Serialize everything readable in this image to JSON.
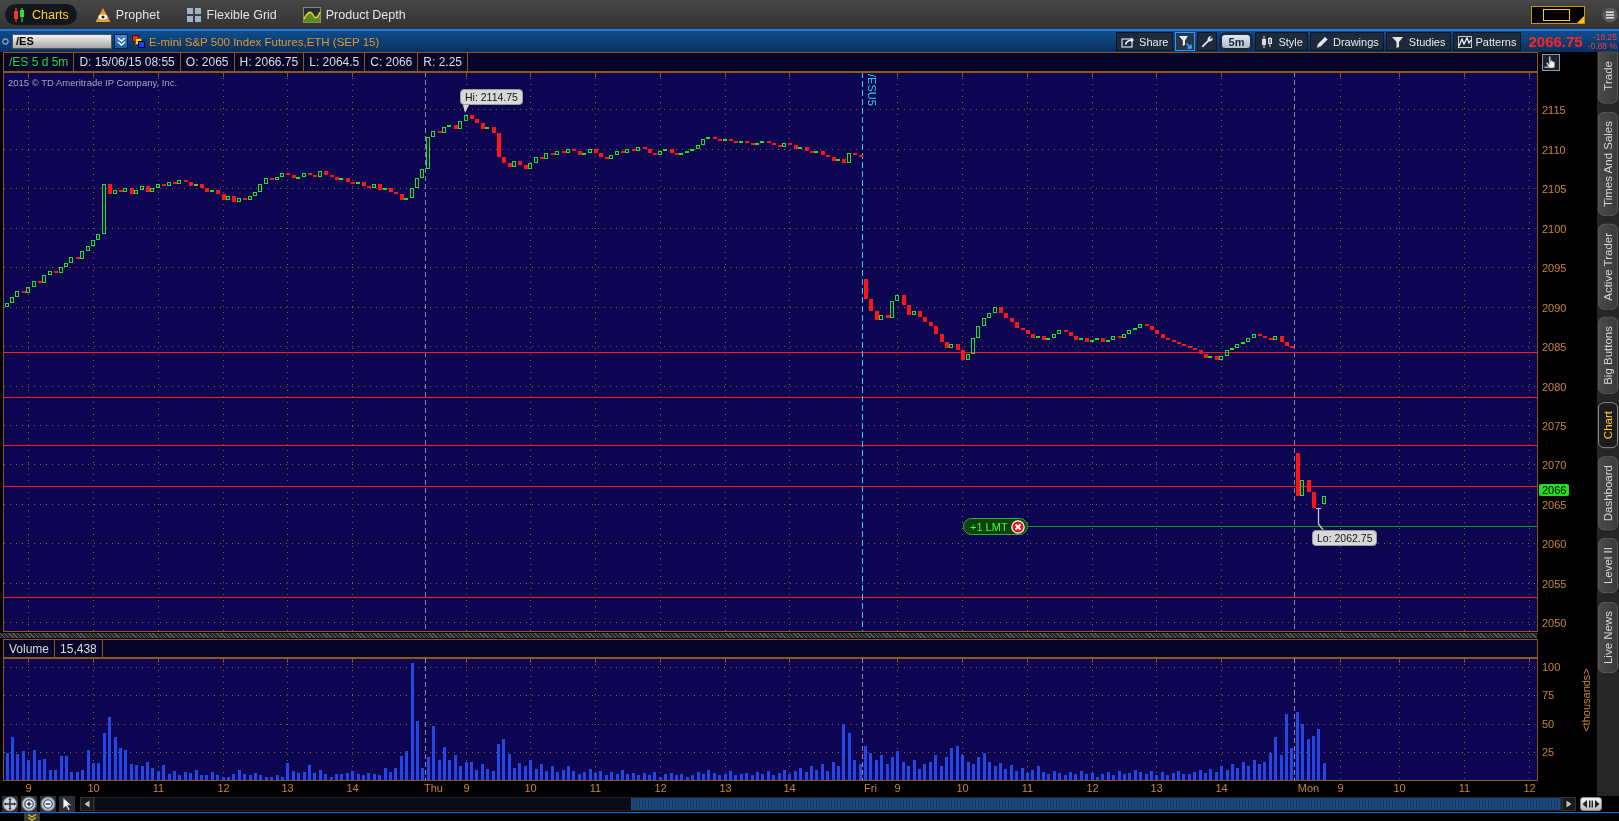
{
  "app_tabs": [
    {
      "label": "Charts",
      "selected": true
    },
    {
      "label": "Prophet",
      "selected": false
    },
    {
      "label": "Flexible Grid",
      "selected": false
    },
    {
      "label": "Product Depth",
      "selected": false
    }
  ],
  "symbol_bar": {
    "symbol": "/ES",
    "description": "E-mini S&P 500 Index Futures,ETH (SEP 15)",
    "buttons": [
      {
        "kind": "text",
        "label": "Share",
        "active": false
      },
      {
        "kind": "icon",
        "active": true
      },
      {
        "kind": "icon",
        "active": false
      },
      {
        "kind": "pill",
        "label": "5m",
        "active": false
      },
      {
        "kind": "text",
        "label": "Style",
        "active": false
      },
      {
        "kind": "text",
        "label": "Drawings",
        "active": false
      },
      {
        "kind": "text",
        "label": "Studies",
        "active": false
      },
      {
        "kind": "text",
        "label": "Patterns",
        "active": false
      }
    ],
    "last_price": "2066.75",
    "net_change": "-18.25",
    "percent_change": "-0.88 %"
  },
  "info_bar": {
    "period": "/ES 5 d 5m",
    "fields": [
      "D: 15/06/15 08:55",
      "O: 2065",
      "H: 2066.75",
      "L: 2064.5",
      "C: 2066",
      "R: 2.25"
    ]
  },
  "price_panel": {
    "copyright": "2015 © TD Ameritrade IP Company, Inc.",
    "axis_labels": [
      "2115",
      "2110",
      "2105",
      "2100",
      "2095",
      "2090",
      "2085",
      "2080",
      "2075",
      "2070",
      "2065",
      "2060",
      "2055",
      "2050"
    ],
    "high_label": "Hi: 2114.75",
    "low_label": "Lo: 2062.75",
    "contract_marker": "/ESU5",
    "order_label": "+1 LMT",
    "last_price_tag": "2066"
  },
  "volume_panel": {
    "title": "Volume",
    "reading": "15,438",
    "chart_data": {
      "type": "bar",
      "ylabel": "<thousands>",
      "grid": true,
      "ylim": [
        0,
        108
      ],
      "yticks": [
        25,
        50,
        75,
        100
      ],
      "categories": [
        null,
        null,
        null,
        null,
        "9",
        null,
        null,
        null,
        null,
        null,
        null,
        null,
        null,
        null,
        null,
        null,
        "10",
        null,
        null,
        null,
        null,
        null,
        null,
        null,
        null,
        null,
        null,
        null,
        "11",
        null,
        null,
        null,
        null,
        null,
        null,
        null,
        null,
        null,
        null,
        null,
        "12",
        null,
        null,
        null,
        null,
        null,
        null,
        null,
        null,
        null,
        null,
        null,
        "13",
        null,
        null,
        null,
        null,
        null,
        null,
        null,
        null,
        null,
        null,
        null,
        "14",
        null,
        null,
        null,
        null,
        null,
        null,
        null,
        null,
        null,
        null,
        null,
        null,
        null,
        null,
        "Thu",
        null,
        null,
        null,
        null,
        null,
        "9",
        null,
        null,
        null,
        null,
        null,
        null,
        null,
        null,
        null,
        null,
        null,
        "10",
        null,
        null,
        null,
        null,
        null,
        null,
        null,
        null,
        null,
        null,
        null,
        "11",
        null,
        null,
        null,
        null,
        null,
        null,
        null,
        null,
        null,
        null,
        null,
        "12",
        null,
        null,
        null,
        null,
        null,
        null,
        null,
        null,
        null,
        null,
        null,
        "13",
        null,
        null,
        null,
        null,
        null,
        null,
        null,
        null,
        null,
        null,
        null,
        "14",
        null,
        null,
        null,
        null,
        null,
        null,
        null,
        null,
        null,
        null,
        null,
        null,
        null,
        null,
        "Fri",
        null,
        null,
        null,
        null,
        "9",
        null,
        null,
        null,
        null,
        null,
        null,
        null,
        null,
        null,
        null,
        null,
        "10",
        null,
        null,
        null,
        null,
        null,
        null,
        null,
        null,
        null,
        null,
        null,
        "11",
        null,
        null,
        null,
        null,
        null,
        null,
        null,
        null,
        null,
        null,
        null,
        "12",
        null,
        null,
        null,
        null,
        null,
        null,
        null,
        null,
        null,
        null,
        null,
        "13",
        null,
        null,
        null,
        null,
        null,
        null,
        null,
        null,
        null,
        null,
        null,
        "14",
        null,
        null,
        null,
        null,
        null,
        null,
        null,
        null,
        null,
        null,
        null,
        null,
        null,
        null,
        null,
        "Mon",
        null,
        null,
        null,
        null,
        null,
        "9",
        null,
        null,
        null,
        null,
        null,
        null,
        null,
        null,
        null,
        null,
        "10",
        null,
        null,
        null,
        null,
        null,
        null,
        null,
        null,
        null,
        null,
        null,
        "11",
        null,
        null,
        null,
        null,
        null,
        null,
        null,
        null,
        null,
        null,
        null,
        "12",
        null
      ],
      "values": [
        24,
        38,
        23,
        26,
        18,
        27,
        18,
        19,
        9,
        9,
        21,
        21,
        7,
        7,
        9,
        27,
        15,
        15,
        42,
        56,
        38,
        28,
        27,
        14,
        13,
        12,
        16,
        11,
        8,
        13,
        5,
        8,
        4,
        7,
        6,
        9,
        4,
        4,
        7,
        4,
        3,
        3,
        5,
        9,
        5,
        4,
        6,
        4,
        3,
        3,
        4,
        3,
        15,
        8,
        6,
        7,
        13,
        6,
        9,
        5,
        3,
        5,
        5,
        6,
        8,
        5,
        4,
        6,
        5,
        4,
        11,
        7,
        11,
        21,
        26,
        104,
        52,
        11,
        20,
        48,
        18,
        29,
        18,
        22,
        12,
        16,
        16,
        9,
        14,
        10,
        8,
        32,
        36,
        23,
        11,
        15,
        12,
        18,
        10,
        14,
        8,
        12,
        7,
        9,
        12,
        8,
        5,
        7,
        10,
        6,
        8,
        4,
        7,
        5,
        9,
        5,
        6,
        4,
        6,
        4,
        7,
        3,
        5,
        6,
        4,
        5,
        3,
        4,
        7,
        5,
        9,
        6,
        4,
        5,
        8,
        4,
        5,
        6,
        4,
        7,
        5,
        8,
        4,
        6,
        9,
        5,
        8,
        11,
        7,
        12,
        9,
        14,
        8,
        16,
        12,
        50,
        42,
        18,
        14,
        30,
        24,
        18,
        22,
        14,
        20,
        26,
        16,
        12,
        18,
        10,
        14,
        16,
        22,
        12,
        20,
        28,
        30,
        22,
        16,
        14,
        20,
        24,
        16,
        12,
        15,
        10,
        13,
        8,
        11,
        6,
        9,
        12,
        7,
        5,
        8,
        6,
        4,
        7,
        5,
        8,
        5,
        6,
        3,
        5,
        7,
        4,
        8,
        5,
        6,
        9,
        7,
        5,
        8,
        4,
        7,
        4,
        6,
        8,
        5,
        5,
        7,
        9,
        6,
        10,
        7,
        12,
        9,
        14,
        11,
        16,
        12,
        18,
        14,
        16,
        24,
        38,
        22,
        58,
        28,
        60,
        50,
        36,
        39,
        45,
        15,
        null,
        null,
        null,
        null,
        null,
        null,
        null,
        null,
        null,
        null,
        null,
        null,
        null,
        null,
        null,
        null,
        null,
        null,
        null,
        null,
        null,
        null,
        null,
        null,
        null,
        null,
        null,
        null,
        null,
        null,
        null,
        null,
        null,
        null,
        null,
        null,
        null,
        null,
        null
      ]
    }
  },
  "side_tabs": [
    {
      "label": "Trade",
      "selected": false
    },
    {
      "label": "Times And Sales",
      "selected": false
    },
    {
      "label": "Active Trader",
      "selected": false
    },
    {
      "label": "Big Buttons",
      "selected": false
    },
    {
      "label": "Chart",
      "selected": true
    },
    {
      "label": "Dashboard",
      "selected": false
    },
    {
      "label": "Level II",
      "selected": false
    },
    {
      "label": "Live News",
      "selected": false
    }
  ]
}
